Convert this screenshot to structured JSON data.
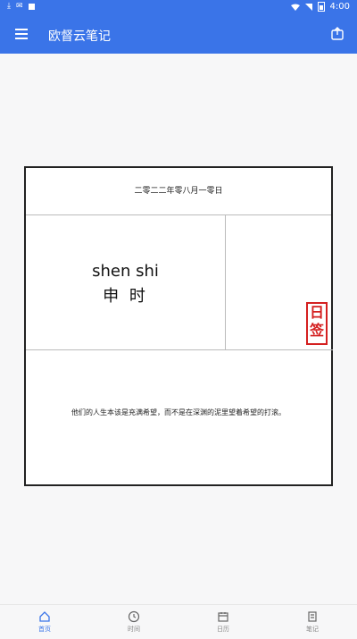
{
  "status_bar": {
    "time": "4:00",
    "left_icons": [
      "download-icon",
      "notification-icon",
      "app-icon"
    ],
    "right_icons": [
      "wifi-icon",
      "signal-icon",
      "battery-icon"
    ]
  },
  "app_bar": {
    "title": "欧督云笔记",
    "menu_icon": "menu-icon",
    "action_icon": "share-icon"
  },
  "card": {
    "date": "二零二二年零八月一零日",
    "pinyin": "shen shi",
    "hanzi": "申 时",
    "seal_text": [
      "日",
      "签"
    ],
    "quote": "他们的人生本该是充满希望，而不是在深渊的泥里望着希望的打滚。"
  },
  "bottom_nav": [
    {
      "label": "首页",
      "icon": "home-icon",
      "active": true
    },
    {
      "label": "时间",
      "icon": "clock-icon",
      "active": false
    },
    {
      "label": "日历",
      "icon": "calendar-icon",
      "active": false
    },
    {
      "label": "笔记",
      "icon": "note-icon",
      "active": false
    }
  ],
  "colors": {
    "primary": "#3a74e8",
    "seal": "#d42020",
    "background": "#f7f7f8"
  }
}
